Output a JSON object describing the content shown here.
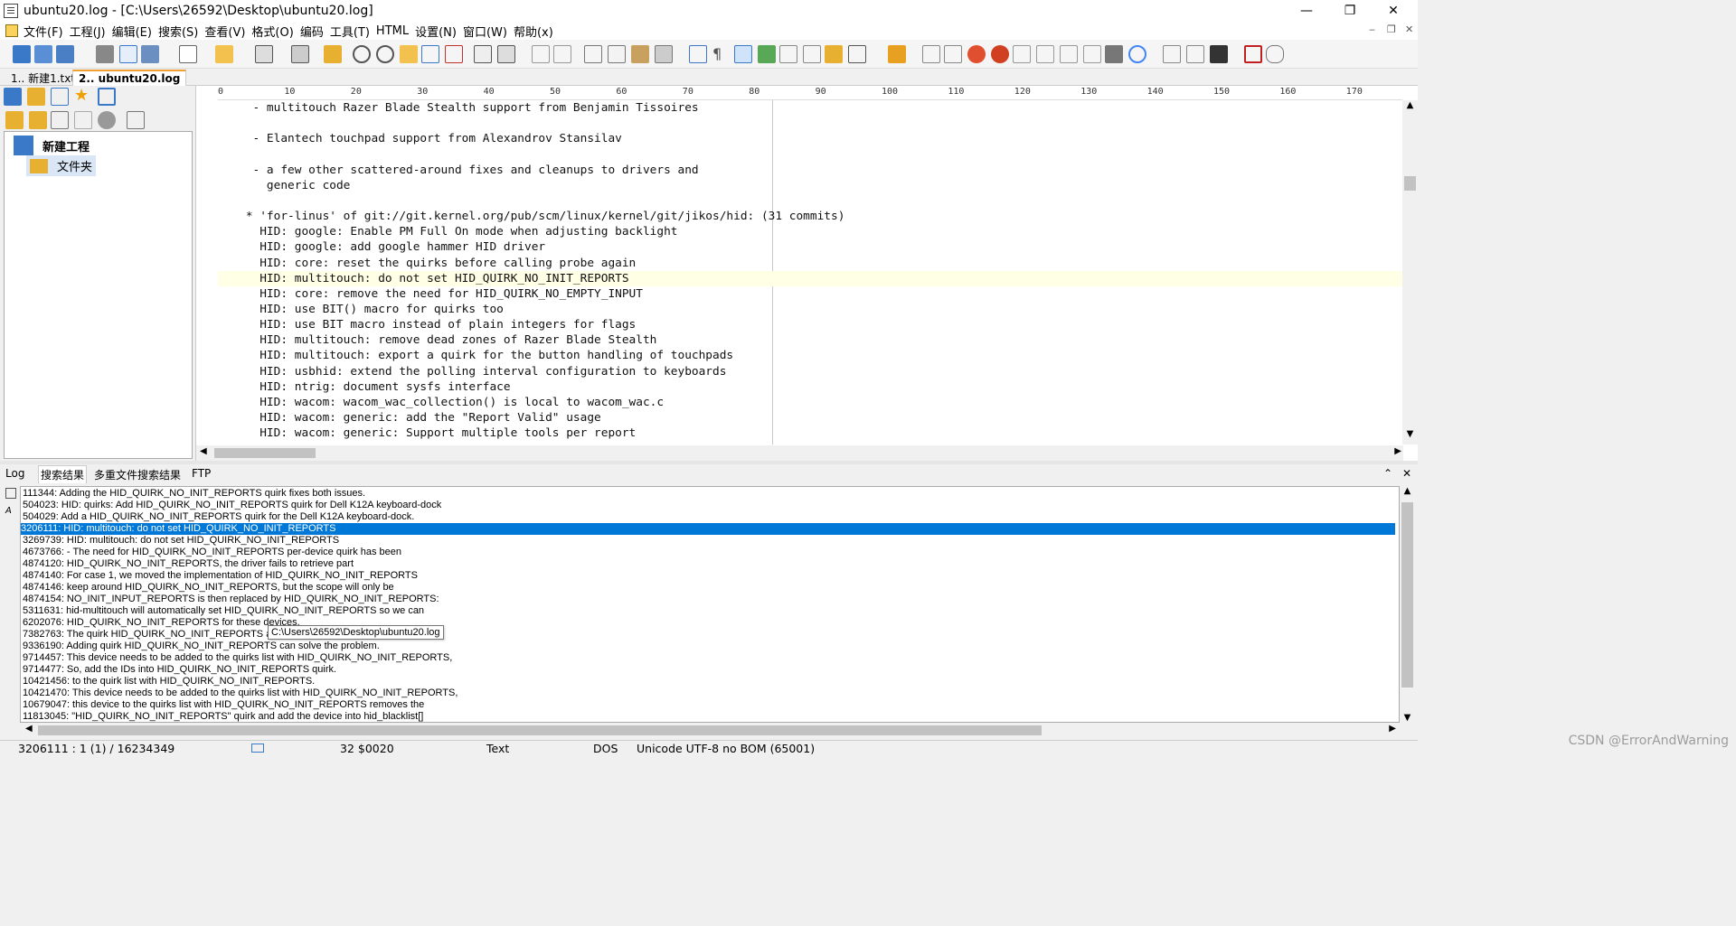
{
  "window": {
    "title": "ubuntu20.log - [C:\\Users\\26592\\Desktop\\ubuntu20.log]",
    "minimize": "—",
    "restore": "❐",
    "close": "✕"
  },
  "menu": [
    "文件(F)",
    "工程(J)",
    "编辑(E)",
    "搜索(S)",
    "查看(V)",
    "格式(O)",
    "编码",
    "工具(T)",
    "HTML",
    "设置(N)",
    "窗口(W)",
    "帮助(x)"
  ],
  "mdi_controls": [
    "‒",
    "❐",
    "✕"
  ],
  "file_tabs": [
    {
      "label": "1.. 新建1.txt",
      "active": false
    },
    {
      "label": "2.. ubuntu20.log",
      "active": true
    }
  ],
  "project_tree": {
    "root": "新建工程",
    "child": "文件夹"
  },
  "ruler": [
    "0",
    "10",
    "20",
    "30",
    "40",
    "50",
    "60",
    "70",
    "80",
    "90",
    "100",
    "110",
    "120",
    "130",
    "140",
    "150",
    "160",
    "170"
  ],
  "editor_lines": [
    {
      "text": "     - multitouch Razer Blade Stealth support from Benjamin Tissoires",
      "highlight": false
    },
    {
      "text": "",
      "highlight": false
    },
    {
      "text": "     - Elantech touchpad support from Alexandrov Stansilav",
      "highlight": false
    },
    {
      "text": "",
      "highlight": false
    },
    {
      "text": "     - a few other scattered-around fixes and cleanups to drivers and",
      "highlight": false
    },
    {
      "text": "       generic code",
      "highlight": false
    },
    {
      "text": "",
      "highlight": false
    },
    {
      "text": "    * 'for-linus' of git://git.kernel.org/pub/scm/linux/kernel/git/jikos/hid: (31 commits)",
      "highlight": false
    },
    {
      "text": "      HID: google: Enable PM Full On mode when adjusting backlight",
      "highlight": false
    },
    {
      "text": "      HID: google: add google hammer HID driver",
      "highlight": false
    },
    {
      "text": "      HID: core: reset the quirks before calling probe again",
      "highlight": false
    },
    {
      "text": "      HID: multitouch: do not set HID_QUIRK_NO_INIT_REPORTS",
      "highlight": true
    },
    {
      "text": "      HID: core: remove the need for HID_QUIRK_NO_EMPTY_INPUT",
      "highlight": false
    },
    {
      "text": "      HID: use BIT() macro for quirks too",
      "highlight": false
    },
    {
      "text": "      HID: use BIT macro instead of plain integers for flags",
      "highlight": false
    },
    {
      "text": "      HID: multitouch: remove dead zones of Razer Blade Stealth",
      "highlight": false
    },
    {
      "text": "      HID: multitouch: export a quirk for the button handling of touchpads",
      "highlight": false
    },
    {
      "text": "      HID: usbhid: extend the polling interval configuration to keyboards",
      "highlight": false
    },
    {
      "text": "      HID: ntrig: document sysfs interface",
      "highlight": false
    },
    {
      "text": "      HID: wacom: wacom_wac_collection() is local to wacom_wac.c",
      "highlight": false
    },
    {
      "text": "      HID: wacom: generic: add the \"Report Valid\" usage",
      "highlight": false
    },
    {
      "text": "      HID: wacom: generic: Support multiple tools per report",
      "highlight": false
    }
  ],
  "output_tabs": [
    {
      "label": "Log",
      "active": false
    },
    {
      "label": "搜索结果",
      "active": true
    },
    {
      "label": "多重文件搜索结果",
      "active": false
    },
    {
      "label": "FTP",
      "active": false
    }
  ],
  "search_results": [
    {
      "text": "111344: Adding the HID_QUIRK_NO_INIT_REPORTS quirk fixes both issues.",
      "selected": false
    },
    {
      "text": "504023: HID: quirks: Add HID_QUIRK_NO_INIT_REPORTS quirk for Dell K12A keyboard-dock",
      "selected": false
    },
    {
      "text": "504029: Add a HID_QUIRK_NO_INIT_REPORTS quirk for the Dell K12A keyboard-dock.",
      "selected": false
    },
    {
      "text": "3206111: HID: multitouch: do not set HID_QUIRK_NO_INIT_REPORTS",
      "selected": true
    },
    {
      "text": "3269739: HID: multitouch: do not set HID_QUIRK_NO_INIT_REPORTS",
      "selected": false
    },
    {
      "text": "4673766: - The need for HID_QUIRK_NO_INIT_REPORTS per-device quirk has been",
      "selected": false
    },
    {
      "text": "4874120: HID_QUIRK_NO_INIT_REPORTS, the driver fails to retrieve part",
      "selected": false
    },
    {
      "text": "4874140: For case 1, we moved the implementation of HID_QUIRK_NO_INIT_REPORTS",
      "selected": false
    },
    {
      "text": "4874146: keep around HID_QUIRK_NO_INIT_REPORTS, but the scope will only be",
      "selected": false
    },
    {
      "text": "4874154: NO_INIT_INPUT_REPORTS is then replaced by HID_QUIRK_NO_INIT_REPORTS:",
      "selected": false
    },
    {
      "text": "5311631: hid-multitouch will automatically set HID_QUIRK_NO_INIT_REPORTS so we can",
      "selected": false
    },
    {
      "text": "6202076: HID_QUIRK_NO_INIT_REPORTS for these devices.",
      "selected": false
    },
    {
      "text": "7382763: The quirk HID_QUIRK_NO_INIT_REPORTS a",
      "selected": false
    },
    {
      "text": "9336190: Adding quirk HID_QUIRK_NO_INIT_REPORTS can solve the problem.",
      "selected": false
    },
    {
      "text": "9714457: This device needs to be added to the quirks list with HID_QUIRK_NO_INIT_REPORTS,",
      "selected": false
    },
    {
      "text": "9714477: So, add the IDs into HID_QUIRK_NO_INIT_REPORTS quirk.",
      "selected": false
    },
    {
      "text": "10421456: to the quirk list with HID_QUIRK_NO_INIT_REPORTS.",
      "selected": false
    },
    {
      "text": "10421470: This device needs to be added to the quirks list with HID_QUIRK_NO_INIT_REPORTS,",
      "selected": false
    },
    {
      "text": "10679047: this device to the quirks list with HID_QUIRK_NO_INIT_REPORTS removes the",
      "selected": false
    },
    {
      "text": "11813045: \"HID_QUIRK_NO_INIT_REPORTS\" quirk and add the device into hid_blacklist[]",
      "selected": false
    }
  ],
  "tooltip": "C:\\Users\\26592\\Desktop\\ubuntu20.log",
  "status": {
    "position": "3206111 : 1 (1) / 16234349",
    "char": "32  $0020",
    "mode": "Text",
    "lineend": "DOS",
    "encoding": "Unicode UTF-8 no BOM (65001)"
  },
  "watermark": "CSDN @ErrorAndWarning",
  "colors": {
    "selection": "#0078d7",
    "current_line": "#ffffe6",
    "tab_accent": "#f0a030"
  }
}
